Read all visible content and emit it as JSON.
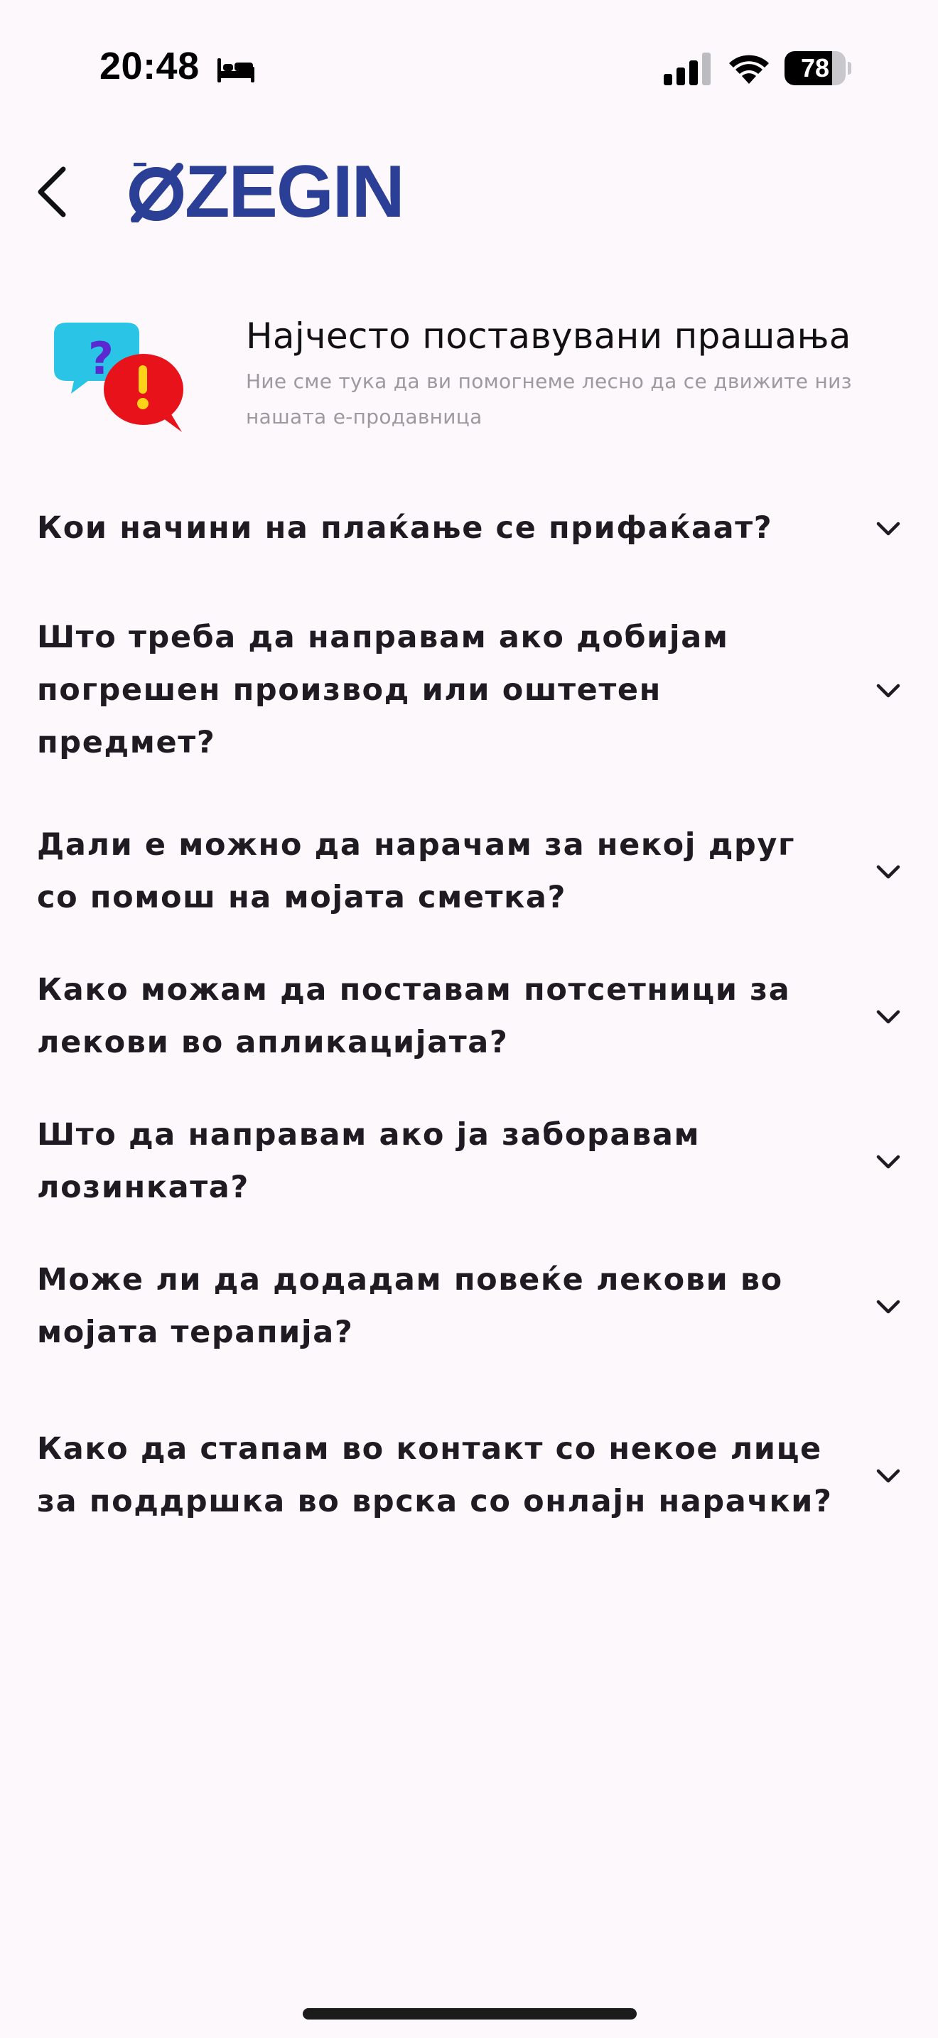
{
  "status_bar": {
    "time": "20:48",
    "battery_level": "78",
    "battery_percent": 78,
    "icons": [
      "bed-icon",
      "cellular-signal-icon",
      "wifi-icon",
      "battery-icon"
    ]
  },
  "header": {
    "back_icon": "chevron-left-icon",
    "brand_name": "ZEGIN",
    "brand_color": "#2b3f97"
  },
  "faq_intro": {
    "title": "Најчесто поставувани прашања",
    "subtitle": "Ние сме тука да ви помогнеме лесно да се движите низ нашата е-продавница",
    "illustration": "chat-bubbles-question-exclamation"
  },
  "faq_items": [
    {
      "question": "Кои начини на плаќање се прифаќаат?"
    },
    {
      "question": "Што треба да направам ако добијам погрешен производ или оштетен предмет?"
    },
    {
      "question": "Дали е можно да нарачам за некој друг со помош на мојата сметка?"
    },
    {
      "question": "Како можам да поставам потсетници за лекови во апликацијата?"
    },
    {
      "question": "Што да направам ако ја заборавам лозинката?"
    },
    {
      "question": "Може ли да додадам повеќе лекови во мојата терапија?"
    },
    {
      "question": "Како да стапам во контакт со некое лице за поддршка во врска со онлајн нарачки?"
    }
  ],
  "colors": {
    "background": "#fcf8fc",
    "text": "#1f1b22",
    "subtitle": "#9c9a9e",
    "bubble_cyan": "#29c4e6",
    "bubble_red": "#e8121a"
  }
}
